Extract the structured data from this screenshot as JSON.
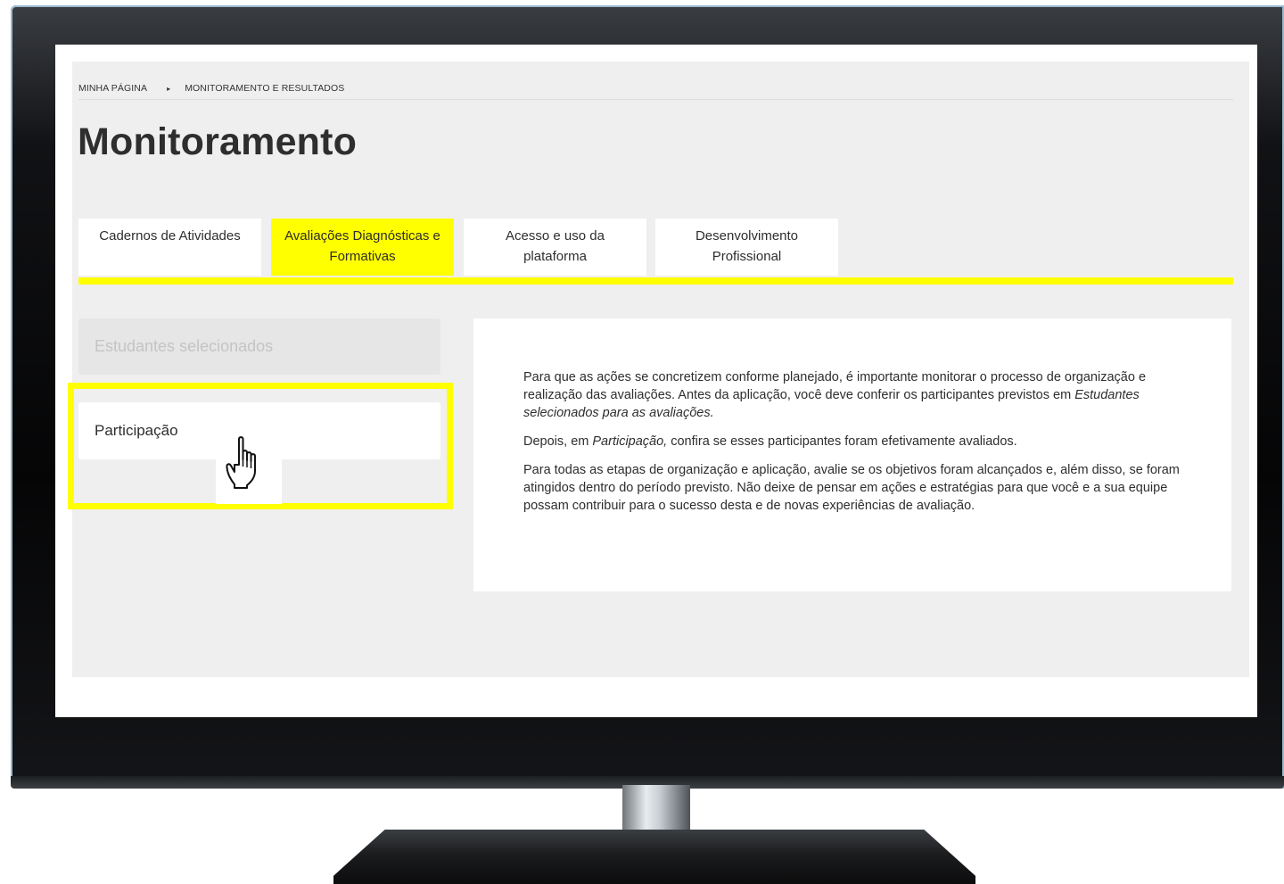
{
  "breadcrumb": {
    "home": "MINHA PÁGINA",
    "separator": "▸",
    "current": "MONITORAMENTO E RESULTADOS"
  },
  "page_title": "Monitoramento",
  "tabs": [
    {
      "label_line1": "Cadernos de Atividades",
      "label_line2": "",
      "active": false
    },
    {
      "label_line1": "Avaliações Diagnósticas e",
      "label_line2": "Formativas",
      "active": true
    },
    {
      "label_line1": "Acesso e uso da",
      "label_line2": "plataforma",
      "active": false
    },
    {
      "label_line1": "Desenvolvimento",
      "label_line2": "Profissional",
      "active": false
    }
  ],
  "sidebar": {
    "disabled_item": "Estudantes selecionados",
    "active_item": "Participação"
  },
  "panel": {
    "p1_start": "Para que as ações se concretizem conforme planejado, é importante monitorar o processo de organização e realização das avaliações. Antes da aplicação, você deve conferir os participantes previstos em ",
    "p1_italic": "Estudantes selecionados para as avaliações.",
    "p2_start": "Depois, em ",
    "p2_italic": "Participação,",
    "p2_end": " confira se esses participantes foram efetivamente avaliados.",
    "p3": "Para todas as etapas de organização e aplicação, avalie se os objetivos foram alcançados e, além disso, se foram atingidos dentro do período previsto. Não deixe de pensar em ações e estratégias para que você e a sua equipe possam contribuir para o sucesso desta e de novas experiências de avaliação."
  },
  "colors": {
    "accent": "#ffff00",
    "content_background": "#efefef",
    "text": "#2e2e2e"
  },
  "icons": {
    "cursor": "hand-pointer-icon",
    "breadcrumb_separator": "triangle-right-icon"
  }
}
